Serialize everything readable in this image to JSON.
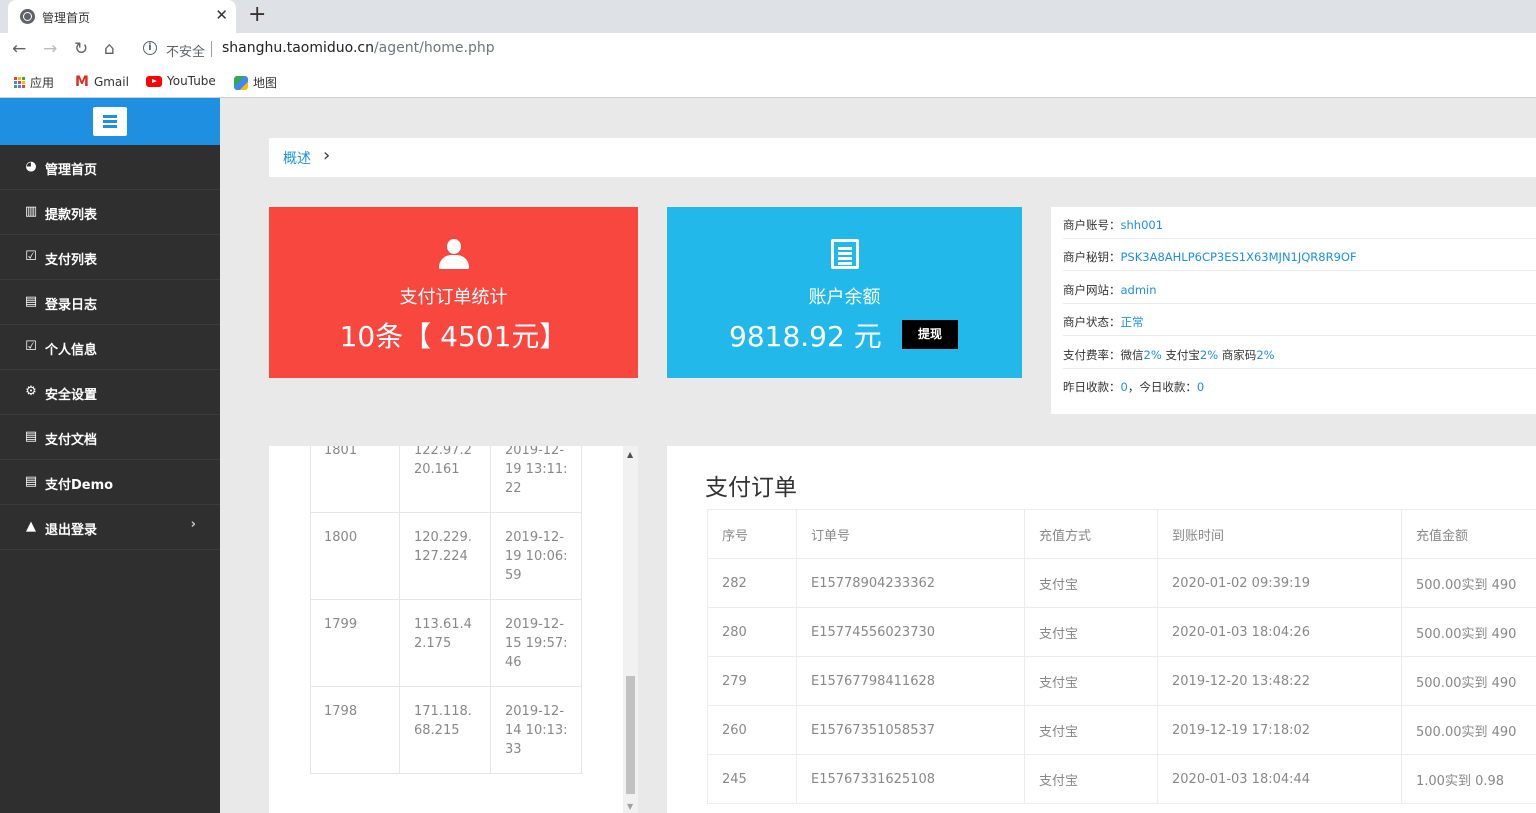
{
  "browser": {
    "tab_title": "管理首页",
    "tab_close": "✕",
    "new_tab": "+",
    "insecure_label": "不安全",
    "url_host": "shanghu.taomiduo.cn",
    "url_path": "/agent/home.php",
    "bookmarks": [
      {
        "label": "应用",
        "icon": "apps-icon"
      },
      {
        "label": "Gmail",
        "icon": "gmail-icon"
      },
      {
        "label": "YouTube",
        "icon": "youtube-icon"
      },
      {
        "label": "地图",
        "icon": "maps-icon"
      }
    ]
  },
  "sidebar": {
    "items": [
      {
        "label": "管理首页",
        "icon": "dashboard-icon"
      },
      {
        "label": "提款列表",
        "icon": "bar-chart-icon"
      },
      {
        "label": "支付列表",
        "icon": "checkbox-icon"
      },
      {
        "label": "登录日志",
        "icon": "document-icon"
      },
      {
        "label": "个人信息",
        "icon": "checkbox-icon"
      },
      {
        "label": "安全设置",
        "icon": "gears-icon"
      },
      {
        "label": "支付文档",
        "icon": "document-icon"
      },
      {
        "label": "支付Demo",
        "icon": "document-icon"
      },
      {
        "label": "退出登录",
        "icon": "warning-icon"
      }
    ]
  },
  "breadcrumb": {
    "label": "概述"
  },
  "cards": {
    "orders": {
      "title": "支付订单统计",
      "value": "10条【 4501元】",
      "icon": "user-icon"
    },
    "balance": {
      "title": "账户余额",
      "value": "9818.92 元",
      "button": "提现",
      "icon": "list-doc-icon"
    }
  },
  "merchant": {
    "account_label": "商户账号：",
    "account": "shh001",
    "secret_label": "商户秘钥：",
    "secret": "PSK3A8AHLP6CP3ES1X63MJN1JQR8R9OF",
    "site_label": "商户网站：",
    "site": "admin",
    "status_label": "商户状态：",
    "status": "正常",
    "rate_label": "支付费率：",
    "wechat_label": "微信",
    "wechat_rate": "2%",
    "alipay_label": "支付宝",
    "alipay_rate": "2%",
    "merchant_code_label": "商家码",
    "merchant_code_rate": "2%",
    "yesterday_label": "昨日收款：",
    "yesterday": "0",
    "today_label": "，今日收款：",
    "today": "0"
  },
  "login_log": {
    "rows": [
      {
        "id": "1801",
        "ip": "122.97.2\n20.161",
        "time": "2019-12-\n19 13:11:\n22"
      },
      {
        "id": "1800",
        "ip": "120.229.\n127.224",
        "time": "2019-12-\n19 10:06:\n59"
      },
      {
        "id": "1799",
        "ip": "113.61.4\n2.175",
        "time": "2019-12-\n15 19:57:\n46"
      },
      {
        "id": "1798",
        "ip": "171.118.\n68.215",
        "time": "2019-12-\n14 10:13:\n33"
      }
    ]
  },
  "orders": {
    "title": "支付订单",
    "headers": [
      "序号",
      "订单号",
      "充值方式",
      "到账时间",
      "充值金额"
    ],
    "rows": [
      [
        "282",
        "E15778904233362",
        "支付宝",
        "2020-01-02 09:39:19",
        "500.00实到 490"
      ],
      [
        "280",
        "E15774556023730",
        "支付宝",
        "2020-01-03 18:04:26",
        "500.00实到 490"
      ],
      [
        "279",
        "E15767798411628",
        "支付宝",
        "2019-12-20 13:48:22",
        "500.00实到 490"
      ],
      [
        "260",
        "E15767351058537",
        "支付宝",
        "2019-12-19 17:18:02",
        "500.00实到 490"
      ],
      [
        "245",
        "E15767331625108",
        "支付宝",
        "2020-01-03 18:04:44",
        "1.00实到 0.98"
      ]
    ]
  },
  "colors": {
    "primary": "#1e8fe1",
    "red_card": "#f8473f",
    "blue_card": "#22b9ea",
    "sidebar": "#2f2f2f"
  }
}
